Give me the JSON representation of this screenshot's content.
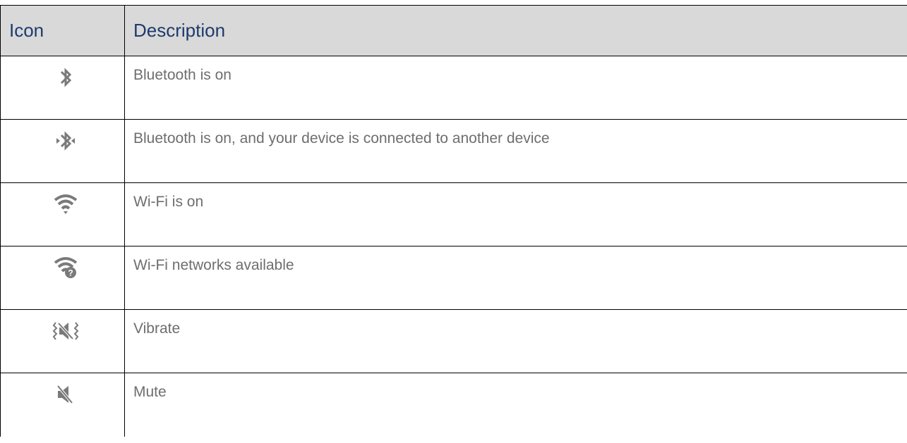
{
  "table": {
    "headers": {
      "icon": "Icon",
      "description": "Description"
    },
    "rows": [
      {
        "icon": "bluetooth-icon",
        "description": "Bluetooth is on"
      },
      {
        "icon": "bluetooth-connected-icon",
        "description": "Bluetooth is on, and your device is connected to another device"
      },
      {
        "icon": "wifi-icon",
        "description": "Wi-Fi is on"
      },
      {
        "icon": "wifi-networks-available-icon",
        "description": "Wi-Fi networks available"
      },
      {
        "icon": "vibrate-icon",
        "description": "Vibrate"
      },
      {
        "icon": "mute-icon",
        "description": "Mute"
      }
    ]
  },
  "colors": {
    "header_bg": "#d9d9d9",
    "header_text": "#1c3b6e",
    "body_text": "#6e6e6e",
    "icon": "#7a7a7a",
    "border": "#000000"
  }
}
